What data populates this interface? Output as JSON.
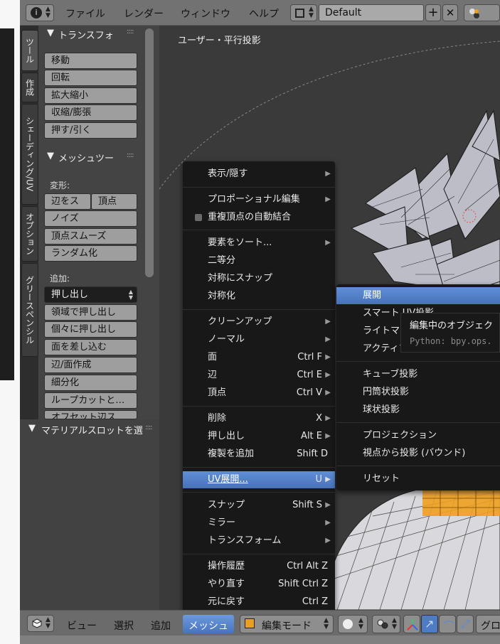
{
  "header": {
    "menus": [
      "ファイル",
      "レンダー",
      "ウィンドウ",
      "ヘルプ"
    ],
    "layout_name": "Default",
    "icons": [
      "info-icon",
      "layout-icon",
      "add-icon",
      "close-icon",
      "scene-icon"
    ]
  },
  "viewport": {
    "label": "ユーザー・平行投影"
  },
  "tool_tabs": [
    "ツール",
    "作成",
    "シェーディング/UV",
    "オプション",
    "グリースペンシル"
  ],
  "transform_panel": {
    "title": "トランスフォ",
    "buttons": [
      "移動",
      "回転",
      "拡大縮小",
      "収縮/膨張",
      "押す/引く"
    ]
  },
  "mesh_tools_panel": {
    "title": "メッシュツー",
    "deform_label": "変形:",
    "deform_split": [
      "辺をス",
      "頂点"
    ],
    "deform_buttons": [
      "ノイズ",
      "頂点スムーズ",
      "ランダム化"
    ],
    "add_label": "追加:",
    "extrude_select": "押し出し",
    "add_buttons": [
      "領域で押し出し",
      "個々に押し出し",
      "面を差し込む",
      "辺/面作成",
      "細分化",
      "ループカットと…",
      "オフセット辺ス"
    ]
  },
  "material_panel": {
    "title": "マテリアルスロットを選"
  },
  "mesh_menu": {
    "items": [
      {
        "label": "表示/隠す",
        "shortcut": "",
        "submenu": true
      },
      {
        "label": "プロポーショナル編集",
        "shortcut": "",
        "submenu": true
      },
      {
        "label": "重複頂点の自動結合",
        "shortcut": "",
        "submenu": false,
        "checkbox": true
      },
      {
        "label": "要素をソート...",
        "shortcut": "",
        "submenu": true
      },
      {
        "label": "二等分",
        "shortcut": "",
        "submenu": false
      },
      {
        "label": "対称にスナップ",
        "shortcut": "",
        "submenu": false
      },
      {
        "label": "対称化",
        "shortcut": "",
        "submenu": false
      },
      {
        "label": "クリーンアップ",
        "shortcut": "",
        "submenu": true
      },
      {
        "label": "ノーマル",
        "shortcut": "",
        "submenu": true
      },
      {
        "label": "面",
        "shortcut": "Ctrl F",
        "submenu": true
      },
      {
        "label": "辺",
        "shortcut": "Ctrl E",
        "submenu": true
      },
      {
        "label": "頂点",
        "shortcut": "Ctrl V",
        "submenu": true
      },
      {
        "label": "削除",
        "shortcut": "X",
        "submenu": true
      },
      {
        "label": "押し出し",
        "shortcut": "Alt E",
        "submenu": true
      },
      {
        "label": "複製を追加",
        "shortcut": "Shift D",
        "submenu": false
      },
      {
        "label": "UV展開...",
        "shortcut": "U",
        "submenu": true,
        "highlighted": true
      },
      {
        "label": "スナップ",
        "shortcut": "Shift S",
        "submenu": true
      },
      {
        "label": "ミラー",
        "shortcut": "",
        "submenu": true
      },
      {
        "label": "トランスフォーム",
        "shortcut": "",
        "submenu": true
      },
      {
        "label": "操作履歴",
        "shortcut": "Ctrl Alt Z",
        "submenu": false
      },
      {
        "label": "やり直す",
        "shortcut": "Shift Ctrl Z",
        "submenu": false
      },
      {
        "label": "元に戻す",
        "shortcut": "Ctrl Z",
        "submenu": false
      }
    ]
  },
  "uv_menu": {
    "items": [
      "展開",
      "スマート UV投影",
      "ライトマップパック",
      "アクティブ四角形面に追従",
      "キューブ投影",
      "円筒状投影",
      "球状投影",
      "プロジェクション",
      "視点から投影 (バウンド)",
      "リセット"
    ]
  },
  "tooltip": {
    "title": "編集中のオブジェク",
    "python": "Python: bpy.ops."
  },
  "bottom_bar": {
    "menus": [
      "ビュー",
      "選択",
      "追加",
      "メッシュ"
    ],
    "mode": "編集モード",
    "extra": "グロ"
  },
  "colors": {
    "highlight": "#5680c8",
    "menu_bg": "#181818",
    "header": "#727272",
    "viewport": "#3a3a3a",
    "selected_faces": "#f0a020"
  }
}
